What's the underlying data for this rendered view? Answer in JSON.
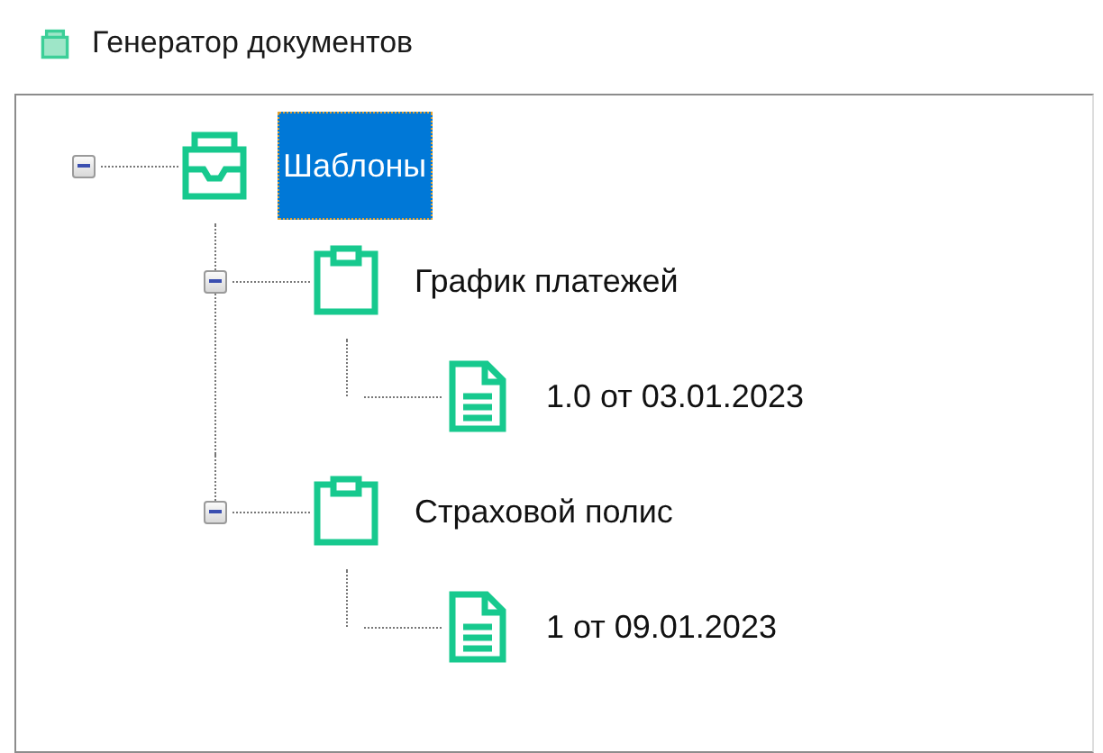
{
  "window": {
    "title": "Генератор документов"
  },
  "tree": [
    {
      "label": "Шаблоны",
      "kind": "inbox",
      "selected": true,
      "expanded": true,
      "children": [
        {
          "label": "График платежей",
          "kind": "clipboard",
          "selected": false,
          "expanded": true,
          "children": [
            {
              "label": "1.0 от 03.01.2023",
              "kind": "document",
              "selected": false
            }
          ]
        },
        {
          "label": "Страховой полис",
          "kind": "clipboard",
          "selected": false,
          "expanded": true,
          "children": [
            {
              "label": "1 от 09.01.2023",
              "kind": "document",
              "selected": false
            }
          ]
        }
      ]
    }
  ]
}
